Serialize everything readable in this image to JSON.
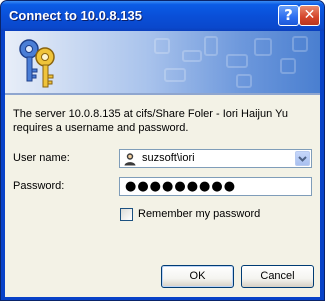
{
  "window": {
    "title": "Connect to 10.0.8.135"
  },
  "titlebar_buttons": {
    "help_glyph": "?",
    "close_glyph": "✕"
  },
  "message": "The server 10.0.8.135 at cifs/Share Foler - Iori Haijun Yu requires a username and password.",
  "form": {
    "username_label": "User name:",
    "username_value": "suzsoft\\iori",
    "password_label": "Password:",
    "password_mask": "●●●●●●●●●",
    "remember_label": "Remember my password",
    "remember_checked": false
  },
  "buttons": {
    "ok": "OK",
    "cancel": "Cancel"
  },
  "icons": {
    "banner": "keys-icon",
    "user": "user-icon",
    "dropdown": "chevron-down-icon"
  }
}
